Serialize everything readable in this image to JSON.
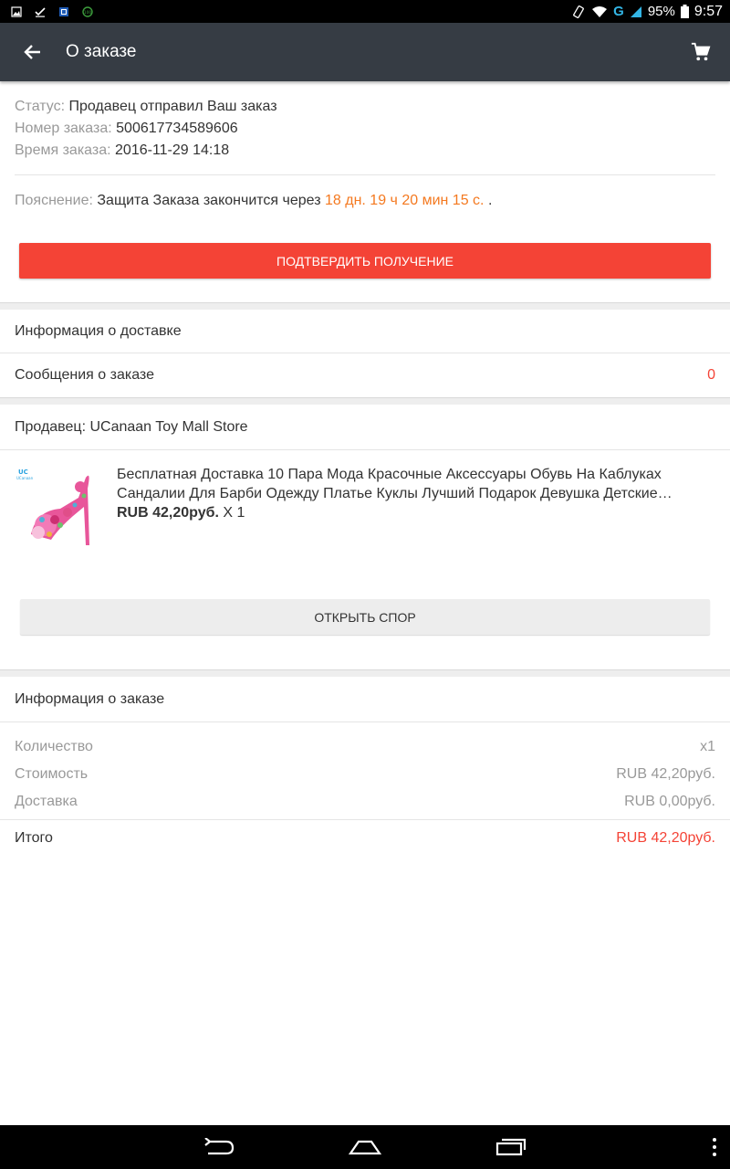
{
  "status_bar": {
    "battery": "95%",
    "time": "9:57",
    "network": "G"
  },
  "toolbar": {
    "title": "О заказе",
    "back_icon": "arrow-back-icon",
    "cart_icon": "cart-icon"
  },
  "order": {
    "status_label": "Статус:",
    "status_value": "Продавец отправил Ваш заказ",
    "number_label": "Номер заказа:",
    "number_value": "500617734589606",
    "time_label": "Время заказа:",
    "time_value": "2016-11-29 14:18",
    "note_label": "Пояснение:",
    "note_text": "Защита Заказа закончится через",
    "note_countdown": "18 дн. 19 ч 20 мин 15 с.",
    "note_end": ".",
    "confirm_button": "ПОДТВЕРДИТЬ ПОЛУЧЕНИЕ"
  },
  "links": {
    "delivery_info": "Информация о доставке",
    "messages": "Сообщения о заказе",
    "messages_count": "0"
  },
  "seller": {
    "label": "Продавец: UCanaan Toy Mall Store"
  },
  "product": {
    "title": "Бесплатная Доставка 10 Пара Мода Красочные Аксессуары Обувь На Каблуках Сандалии Для Барби Одежду Платье Куклы Лучший Подарок Девушка Детские Игрушки",
    "price": "RUB 42,20руб.",
    "quantity": "X 1",
    "dispute_button": "ОТКРЫТЬ СПОР"
  },
  "summary": {
    "header": "Информация о заказе",
    "quantity_label": "Количество",
    "quantity_value": "x1",
    "cost_label": "Стоимость",
    "cost_value": "RUB 42,20руб.",
    "shipping_label": "Доставка",
    "shipping_value": "RUB 0,00руб.",
    "total_label": "Итого",
    "total_value": "RUB 42,20руб."
  },
  "colors": {
    "toolbar": "#363c44",
    "accent_red": "#f44336",
    "countdown_orange": "#f47920"
  }
}
